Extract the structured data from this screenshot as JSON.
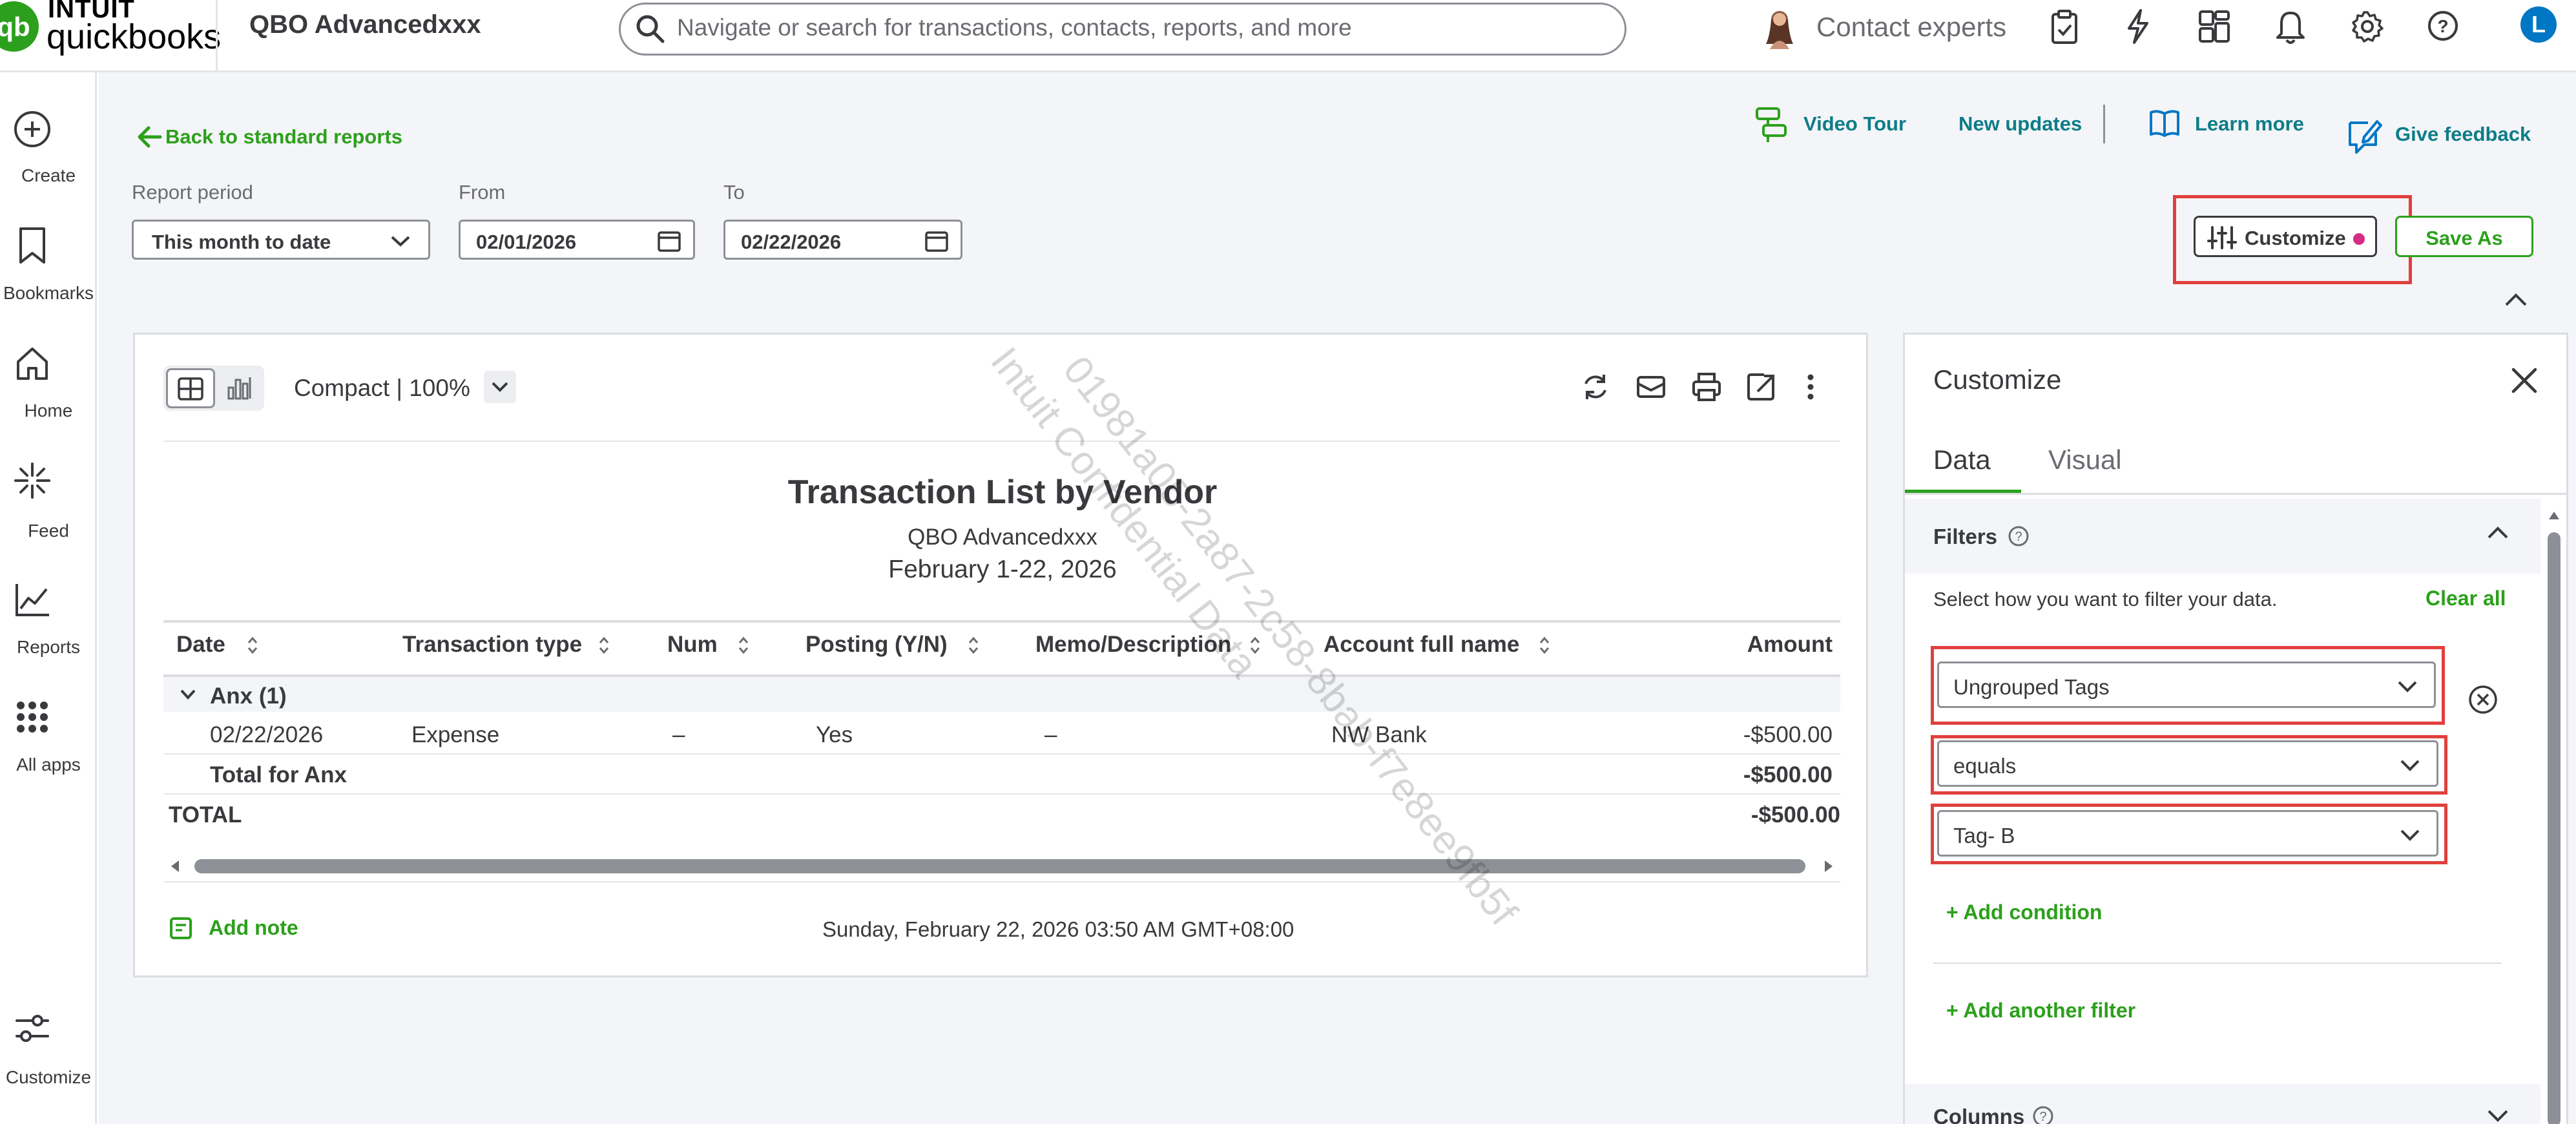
{
  "topbar": {
    "logo_intuit": "INTUIT",
    "logo_qb": "quickbooks",
    "company_name": "QBO Advancedxxx",
    "search_placeholder": "Navigate or search for transactions, contacts, reports, and more",
    "contact_experts": "Contact experts",
    "avatar_letter": "L"
  },
  "leftnav": {
    "items": [
      {
        "label": "Create",
        "icon": "plus-circle-icon"
      },
      {
        "label": "Bookmarks",
        "icon": "bookmark-icon"
      },
      {
        "label": "Home",
        "icon": "home-icon"
      },
      {
        "label": "Feed",
        "icon": "sparkle-icon"
      },
      {
        "label": "Reports",
        "icon": "chart-icon"
      },
      {
        "label": "All apps",
        "icon": "grid-icon"
      },
      {
        "label": "Customize",
        "icon": "sliders-icon"
      }
    ]
  },
  "toolbar": {
    "back_link": "Back to standard reports",
    "video_tour": "Video Tour",
    "new_updates": "New updates",
    "learn_more": "Learn more",
    "give_feedback": "Give feedback",
    "report_period_label": "Report period",
    "report_period_value": "This month to date",
    "from_label": "From",
    "from_value": "02/01/2026",
    "to_label": "To",
    "to_value": "02/22/2026",
    "customize_label": "Customize",
    "save_as_label": "Save As"
  },
  "watermark": {
    "line1": "01981a05-2a87-2c58-8bab-f7e8ee9fb5f",
    "line2": "Intuit Confidential Data"
  },
  "report": {
    "view_label": "Compact | 100%",
    "title": "Transaction List by Vendor",
    "company": "QBO Advancedxxx",
    "date_range": "February 1-22, 2026",
    "columns": [
      "Date",
      "Transaction type",
      "Num",
      "Posting (Y/N)",
      "Memo/Description",
      "Account full name",
      "Amount"
    ],
    "group_label": "Anx (1)",
    "row": {
      "date": "02/22/2026",
      "type": "Expense",
      "num": "–",
      "posting": "Yes",
      "memo": "–",
      "account": "NW Bank",
      "amount": "-$500.00"
    },
    "total_for_label": "Total for Anx",
    "total_for_amount": "-$500.00",
    "total_label": "TOTAL",
    "total_amount": "-$500.00",
    "add_note": "Add note",
    "timestamp": "Sunday, February 22, 2026 03:50 AM GMT+08:00"
  },
  "panel": {
    "title": "Customize",
    "tabs": [
      "Data",
      "Visual"
    ],
    "active_tab": "Data",
    "filters_label": "Filters",
    "filter_help": "Select how you want to filter your data.",
    "clear_all": "Clear all",
    "filter_field": "Ungrouped Tags",
    "filter_operator": "equals",
    "filter_value": "Tag- B",
    "add_condition": "+ Add condition",
    "add_another_filter": "+ Add another filter",
    "columns_label": "Columns"
  },
  "colors": {
    "brand_green": "#2ca01c",
    "link_teal": "#0d7d88",
    "highlight_red": "#e0403d",
    "dot_pink": "#d52b85",
    "avatar_blue": "#0077c5"
  }
}
